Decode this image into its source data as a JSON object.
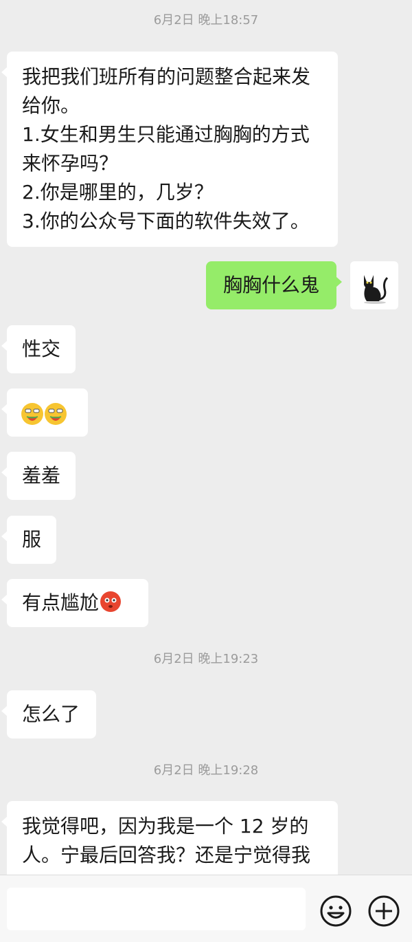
{
  "chat": {
    "timestamps": [
      "6月2日 晚上18:57",
      "6月2日 晚上19:23",
      "6月2日 晚上19:28"
    ],
    "messages": [
      {
        "side": "left",
        "text": "我把我们班所有的问题整合起来发\n给你。\n1.女生和男生只能通过胸胸的方式\n来怀孕吗？\n2.你是哪里的，几岁？\n3.你的公众号下面的软件失效了。"
      },
      {
        "side": "right",
        "text": "胸胸什么鬼"
      },
      {
        "side": "left",
        "text": "性交"
      },
      {
        "side": "left",
        "emoji": "watermelon-eating-face"
      },
      {
        "side": "left",
        "text": "羞羞"
      },
      {
        "side": "left",
        "text": "服"
      },
      {
        "side": "left",
        "text": "有点尴尬",
        "emoji": "flushed-face"
      },
      {
        "side": "left",
        "text": "怎么了"
      },
      {
        "side": "left",
        "text": "我觉得吧，因为我是一个 12 岁的\n人。宁最后回答我？还是宁觉得我"
      }
    ],
    "avatar": "black-cat-avatar"
  },
  "input_bar": {
    "value": "",
    "emoji_icon": "smiley-icon",
    "more_icon": "plus-circle-icon"
  },
  "colors": {
    "background": "#ededed",
    "incoming_bubble": "#ffffff",
    "outgoing_bubble": "#95ec69"
  }
}
